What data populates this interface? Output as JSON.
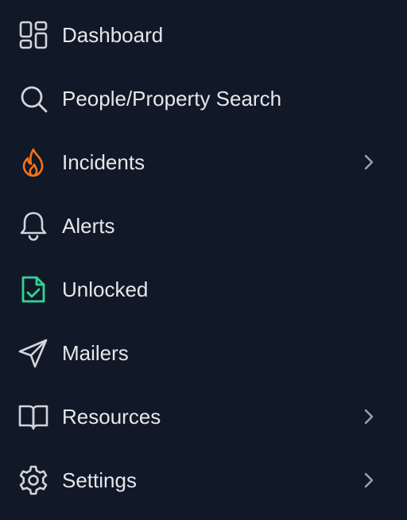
{
  "colors": {
    "background": "#111827",
    "text": "#e5e7eb",
    "icon_default": "#d1d5db",
    "icon_incidents": "#f97316",
    "icon_unlocked": "#34d399",
    "chevron": "#9ca3af"
  },
  "nav": {
    "items": [
      {
        "label": "Dashboard",
        "icon": "dashboard-grid-icon",
        "has_submenu": false
      },
      {
        "label": "People/Property Search",
        "icon": "search-icon",
        "has_submenu": false
      },
      {
        "label": "Incidents",
        "icon": "flame-icon",
        "has_submenu": true
      },
      {
        "label": "Alerts",
        "icon": "bell-icon",
        "has_submenu": false
      },
      {
        "label": "Unlocked",
        "icon": "document-check-icon",
        "has_submenu": false
      },
      {
        "label": "Mailers",
        "icon": "paper-plane-icon",
        "has_submenu": false
      },
      {
        "label": "Resources",
        "icon": "book-open-icon",
        "has_submenu": true
      },
      {
        "label": "Settings",
        "icon": "gear-icon",
        "has_submenu": true
      }
    ]
  }
}
